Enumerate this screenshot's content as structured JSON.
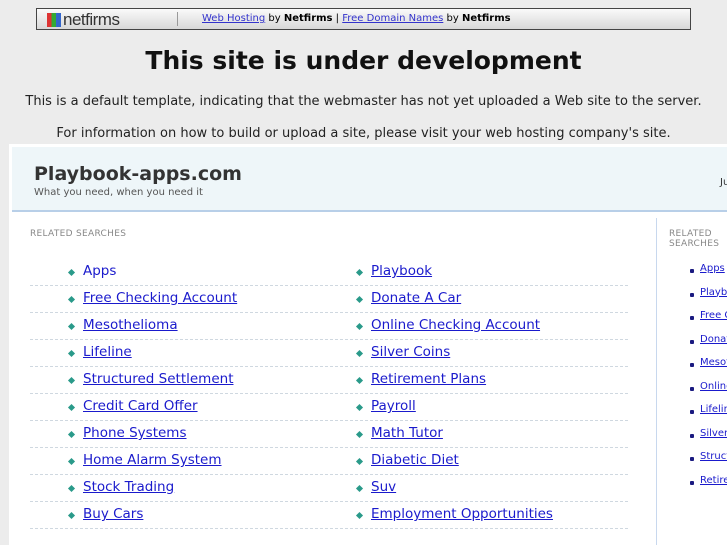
{
  "topbar": {
    "logo": "netfirms",
    "link1": "Web Hosting",
    "by1": " by ",
    "brand1": "Netfirms",
    "pipe": " | ",
    "link2": "Free Domain Names",
    "by2": " by ",
    "brand2": "Netfirms"
  },
  "title": "This site is under development",
  "info1": "This is a default template, indicating that the webmaster has not yet uploaded a Web site to the server.",
  "info2": "For information on how to build or upload a site, please visit your web hosting company's site.",
  "site": {
    "name": "Playbook-apps.com",
    "tagline": "What you need, when you need it",
    "right": "Ju"
  },
  "related_label": "RELATED SEARCHES",
  "links_left": [
    "Apps",
    "Free Checking Account",
    "Mesothelioma",
    "Lifeline",
    "Structured Settlement",
    "Credit Card Offer",
    "Phone Systems",
    "Home Alarm System",
    "Stock Trading",
    "Buy Cars"
  ],
  "links_right": [
    "Playbook",
    "Donate A Car",
    "Online Checking Account",
    "Silver Coins",
    "Retirement Plans",
    "Payroll",
    "Math Tutor",
    "Diabetic Diet",
    "Suv",
    "Employment Opportunities"
  ],
  "side_label": "RELATED SEARCHES",
  "side_links": [
    "Apps",
    "Playbook",
    "Free Checking Account",
    "Donate A Car",
    "Mesothelioma",
    "Online Checking Account",
    "Lifeline",
    "Silver Coins",
    "Structured Settlement",
    "Retirement Plans"
  ]
}
